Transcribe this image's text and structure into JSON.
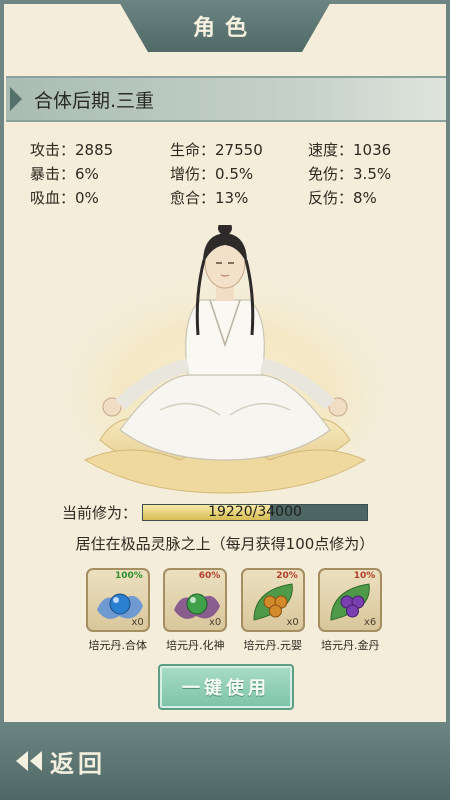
{
  "header": {
    "title": "角色"
  },
  "rank": {
    "text": "合体后期.三重"
  },
  "stats": [
    {
      "label": "攻击：",
      "value": "2885"
    },
    {
      "label": "生命：",
      "value": "27550"
    },
    {
      "label": "速度：",
      "value": "1036"
    },
    {
      "label": "暴击：",
      "value": "6%"
    },
    {
      "label": "增伤：",
      "value": "0.5%"
    },
    {
      "label": "免伤：",
      "value": "3.5%"
    },
    {
      "label": "吸血：",
      "value": "0%"
    },
    {
      "label": "愈合：",
      "value": "13%"
    },
    {
      "label": "反伤：",
      "value": "8%"
    }
  ],
  "cultivation": {
    "label": "当前修为：",
    "current": 19220,
    "max": 34000,
    "text": "19220/34000"
  },
  "residence": {
    "text": "居住在极品灵脉之上（每月获得100点修为）"
  },
  "items": [
    {
      "name": "培元丹.合体",
      "rate": "100%",
      "count": "x0",
      "rate_color": "#2f8f2f",
      "orb_color": "#2a7fd0",
      "icon": "blue-pill-icon"
    },
    {
      "name": "培元丹.化神",
      "rate": "60%",
      "count": "x0",
      "rate_color": "#b0402a",
      "orb_color": "#3fa24a",
      "icon": "green-pill-icon"
    },
    {
      "name": "培元丹.元婴",
      "rate": "20%",
      "count": "x0",
      "rate_color": "#b0402a",
      "orb_color": "#d48a2a",
      "icon": "orange-pills-icon"
    },
    {
      "name": "培元丹.金丹",
      "rate": "10%",
      "count": "x6",
      "rate_color": "#b0402a",
      "orb_color": "#7a3fb0",
      "icon": "purple-pills-icon"
    }
  ],
  "actions": {
    "use_all": "一键使用",
    "back": "返回"
  },
  "colors": {
    "accent": "#6c8582",
    "button": "#7cc3a9",
    "background": "#f4edd9"
  }
}
